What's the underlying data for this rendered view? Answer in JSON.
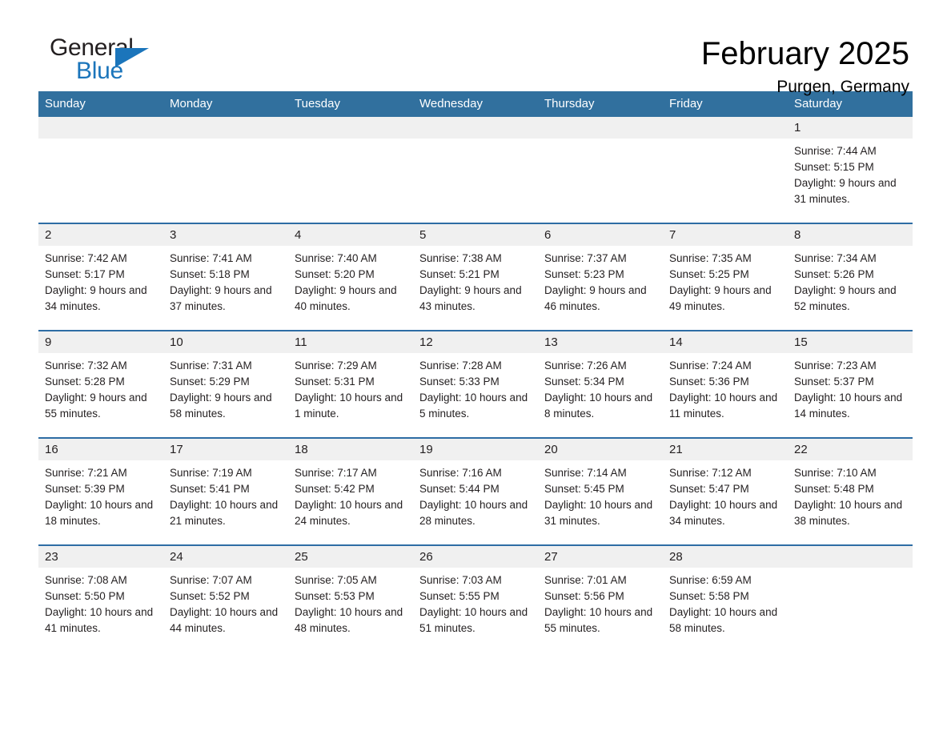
{
  "brand": {
    "name_part1": "General",
    "name_part2": "Blue",
    "triangle_color": "#1b75bb"
  },
  "header": {
    "title": "February 2025",
    "subtitle": "Purgen, Germany"
  },
  "theme": {
    "header_band": "#31709e",
    "row_divider": "#2e6da4",
    "daynum_band": "#f0f0f0",
    "text": "#231f20"
  },
  "weekdays": [
    "Sunday",
    "Monday",
    "Tuesday",
    "Wednesday",
    "Thursday",
    "Friday",
    "Saturday"
  ],
  "labels": {
    "sunrise_prefix": "Sunrise:",
    "sunset_prefix": "Sunset:",
    "daylight_prefix": "Daylight:"
  },
  "weeks": [
    [
      {
        "day": "",
        "empty": true
      },
      {
        "day": "",
        "empty": true
      },
      {
        "day": "",
        "empty": true
      },
      {
        "day": "",
        "empty": true
      },
      {
        "day": "",
        "empty": true
      },
      {
        "day": "",
        "empty": true
      },
      {
        "day": "1",
        "sunrise": "Sunrise: 7:44 AM",
        "sunset": "Sunset: 5:15 PM",
        "daylight": "Daylight: 9 hours and 31 minutes."
      }
    ],
    [
      {
        "day": "2",
        "sunrise": "Sunrise: 7:42 AM",
        "sunset": "Sunset: 5:17 PM",
        "daylight": "Daylight: 9 hours and 34 minutes."
      },
      {
        "day": "3",
        "sunrise": "Sunrise: 7:41 AM",
        "sunset": "Sunset: 5:18 PM",
        "daylight": "Daylight: 9 hours and 37 minutes."
      },
      {
        "day": "4",
        "sunrise": "Sunrise: 7:40 AM",
        "sunset": "Sunset: 5:20 PM",
        "daylight": "Daylight: 9 hours and 40 minutes."
      },
      {
        "day": "5",
        "sunrise": "Sunrise: 7:38 AM",
        "sunset": "Sunset: 5:21 PM",
        "daylight": "Daylight: 9 hours and 43 minutes."
      },
      {
        "day": "6",
        "sunrise": "Sunrise: 7:37 AM",
        "sunset": "Sunset: 5:23 PM",
        "daylight": "Daylight: 9 hours and 46 minutes."
      },
      {
        "day": "7",
        "sunrise": "Sunrise: 7:35 AM",
        "sunset": "Sunset: 5:25 PM",
        "daylight": "Daylight: 9 hours and 49 minutes."
      },
      {
        "day": "8",
        "sunrise": "Sunrise: 7:34 AM",
        "sunset": "Sunset: 5:26 PM",
        "daylight": "Daylight: 9 hours and 52 minutes."
      }
    ],
    [
      {
        "day": "9",
        "sunrise": "Sunrise: 7:32 AM",
        "sunset": "Sunset: 5:28 PM",
        "daylight": "Daylight: 9 hours and 55 minutes."
      },
      {
        "day": "10",
        "sunrise": "Sunrise: 7:31 AM",
        "sunset": "Sunset: 5:29 PM",
        "daylight": "Daylight: 9 hours and 58 minutes."
      },
      {
        "day": "11",
        "sunrise": "Sunrise: 7:29 AM",
        "sunset": "Sunset: 5:31 PM",
        "daylight": "Daylight: 10 hours and 1 minute."
      },
      {
        "day": "12",
        "sunrise": "Sunrise: 7:28 AM",
        "sunset": "Sunset: 5:33 PM",
        "daylight": "Daylight: 10 hours and 5 minutes."
      },
      {
        "day": "13",
        "sunrise": "Sunrise: 7:26 AM",
        "sunset": "Sunset: 5:34 PM",
        "daylight": "Daylight: 10 hours and 8 minutes."
      },
      {
        "day": "14",
        "sunrise": "Sunrise: 7:24 AM",
        "sunset": "Sunset: 5:36 PM",
        "daylight": "Daylight: 10 hours and 11 minutes."
      },
      {
        "day": "15",
        "sunrise": "Sunrise: 7:23 AM",
        "sunset": "Sunset: 5:37 PM",
        "daylight": "Daylight: 10 hours and 14 minutes."
      }
    ],
    [
      {
        "day": "16",
        "sunrise": "Sunrise: 7:21 AM",
        "sunset": "Sunset: 5:39 PM",
        "daylight": "Daylight: 10 hours and 18 minutes."
      },
      {
        "day": "17",
        "sunrise": "Sunrise: 7:19 AM",
        "sunset": "Sunset: 5:41 PM",
        "daylight": "Daylight: 10 hours and 21 minutes."
      },
      {
        "day": "18",
        "sunrise": "Sunrise: 7:17 AM",
        "sunset": "Sunset: 5:42 PM",
        "daylight": "Daylight: 10 hours and 24 minutes."
      },
      {
        "day": "19",
        "sunrise": "Sunrise: 7:16 AM",
        "sunset": "Sunset: 5:44 PM",
        "daylight": "Daylight: 10 hours and 28 minutes."
      },
      {
        "day": "20",
        "sunrise": "Sunrise: 7:14 AM",
        "sunset": "Sunset: 5:45 PM",
        "daylight": "Daylight: 10 hours and 31 minutes."
      },
      {
        "day": "21",
        "sunrise": "Sunrise: 7:12 AM",
        "sunset": "Sunset: 5:47 PM",
        "daylight": "Daylight: 10 hours and 34 minutes."
      },
      {
        "day": "22",
        "sunrise": "Sunrise: 7:10 AM",
        "sunset": "Sunset: 5:48 PM",
        "daylight": "Daylight: 10 hours and 38 minutes."
      }
    ],
    [
      {
        "day": "23",
        "sunrise": "Sunrise: 7:08 AM",
        "sunset": "Sunset: 5:50 PM",
        "daylight": "Daylight: 10 hours and 41 minutes."
      },
      {
        "day": "24",
        "sunrise": "Sunrise: 7:07 AM",
        "sunset": "Sunset: 5:52 PM",
        "daylight": "Daylight: 10 hours and 44 minutes."
      },
      {
        "day": "25",
        "sunrise": "Sunrise: 7:05 AM",
        "sunset": "Sunset: 5:53 PM",
        "daylight": "Daylight: 10 hours and 48 minutes."
      },
      {
        "day": "26",
        "sunrise": "Sunrise: 7:03 AM",
        "sunset": "Sunset: 5:55 PM",
        "daylight": "Daylight: 10 hours and 51 minutes."
      },
      {
        "day": "27",
        "sunrise": "Sunrise: 7:01 AM",
        "sunset": "Sunset: 5:56 PM",
        "daylight": "Daylight: 10 hours and 55 minutes."
      },
      {
        "day": "28",
        "sunrise": "Sunrise: 6:59 AM",
        "sunset": "Sunset: 5:58 PM",
        "daylight": "Daylight: 10 hours and 58 minutes."
      },
      {
        "day": "",
        "empty": true
      }
    ]
  ]
}
